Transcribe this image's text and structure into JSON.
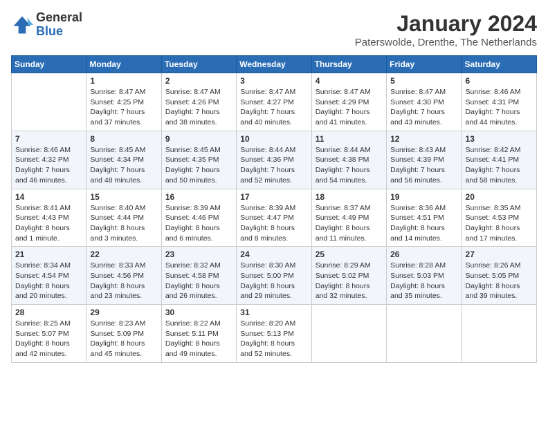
{
  "header": {
    "logo_general": "General",
    "logo_blue": "Blue",
    "month_title": "January 2024",
    "location": "Paterswolde, Drenthe, The Netherlands"
  },
  "weekdays": [
    "Sunday",
    "Monday",
    "Tuesday",
    "Wednesday",
    "Thursday",
    "Friday",
    "Saturday"
  ],
  "weeks": [
    [
      {
        "day": "",
        "sunrise": "",
        "sunset": "",
        "daylight": ""
      },
      {
        "day": "1",
        "sunrise": "Sunrise: 8:47 AM",
        "sunset": "Sunset: 4:25 PM",
        "daylight": "Daylight: 7 hours and 37 minutes."
      },
      {
        "day": "2",
        "sunrise": "Sunrise: 8:47 AM",
        "sunset": "Sunset: 4:26 PM",
        "daylight": "Daylight: 7 hours and 38 minutes."
      },
      {
        "day": "3",
        "sunrise": "Sunrise: 8:47 AM",
        "sunset": "Sunset: 4:27 PM",
        "daylight": "Daylight: 7 hours and 40 minutes."
      },
      {
        "day": "4",
        "sunrise": "Sunrise: 8:47 AM",
        "sunset": "Sunset: 4:29 PM",
        "daylight": "Daylight: 7 hours and 41 minutes."
      },
      {
        "day": "5",
        "sunrise": "Sunrise: 8:47 AM",
        "sunset": "Sunset: 4:30 PM",
        "daylight": "Daylight: 7 hours and 43 minutes."
      },
      {
        "day": "6",
        "sunrise": "Sunrise: 8:46 AM",
        "sunset": "Sunset: 4:31 PM",
        "daylight": "Daylight: 7 hours and 44 minutes."
      }
    ],
    [
      {
        "day": "7",
        "sunrise": "Sunrise: 8:46 AM",
        "sunset": "Sunset: 4:32 PM",
        "daylight": "Daylight: 7 hours and 46 minutes."
      },
      {
        "day": "8",
        "sunrise": "Sunrise: 8:45 AM",
        "sunset": "Sunset: 4:34 PM",
        "daylight": "Daylight: 7 hours and 48 minutes."
      },
      {
        "day": "9",
        "sunrise": "Sunrise: 8:45 AM",
        "sunset": "Sunset: 4:35 PM",
        "daylight": "Daylight: 7 hours and 50 minutes."
      },
      {
        "day": "10",
        "sunrise": "Sunrise: 8:44 AM",
        "sunset": "Sunset: 4:36 PM",
        "daylight": "Daylight: 7 hours and 52 minutes."
      },
      {
        "day": "11",
        "sunrise": "Sunrise: 8:44 AM",
        "sunset": "Sunset: 4:38 PM",
        "daylight": "Daylight: 7 hours and 54 minutes."
      },
      {
        "day": "12",
        "sunrise": "Sunrise: 8:43 AM",
        "sunset": "Sunset: 4:39 PM",
        "daylight": "Daylight: 7 hours and 56 minutes."
      },
      {
        "day": "13",
        "sunrise": "Sunrise: 8:42 AM",
        "sunset": "Sunset: 4:41 PM",
        "daylight": "Daylight: 7 hours and 58 minutes."
      }
    ],
    [
      {
        "day": "14",
        "sunrise": "Sunrise: 8:41 AM",
        "sunset": "Sunset: 4:43 PM",
        "daylight": "Daylight: 8 hours and 1 minute."
      },
      {
        "day": "15",
        "sunrise": "Sunrise: 8:40 AM",
        "sunset": "Sunset: 4:44 PM",
        "daylight": "Daylight: 8 hours and 3 minutes."
      },
      {
        "day": "16",
        "sunrise": "Sunrise: 8:39 AM",
        "sunset": "Sunset: 4:46 PM",
        "daylight": "Daylight: 8 hours and 6 minutes."
      },
      {
        "day": "17",
        "sunrise": "Sunrise: 8:39 AM",
        "sunset": "Sunset: 4:47 PM",
        "daylight": "Daylight: 8 hours and 8 minutes."
      },
      {
        "day": "18",
        "sunrise": "Sunrise: 8:37 AM",
        "sunset": "Sunset: 4:49 PM",
        "daylight": "Daylight: 8 hours and 11 minutes."
      },
      {
        "day": "19",
        "sunrise": "Sunrise: 8:36 AM",
        "sunset": "Sunset: 4:51 PM",
        "daylight": "Daylight: 8 hours and 14 minutes."
      },
      {
        "day": "20",
        "sunrise": "Sunrise: 8:35 AM",
        "sunset": "Sunset: 4:53 PM",
        "daylight": "Daylight: 8 hours and 17 minutes."
      }
    ],
    [
      {
        "day": "21",
        "sunrise": "Sunrise: 8:34 AM",
        "sunset": "Sunset: 4:54 PM",
        "daylight": "Daylight: 8 hours and 20 minutes."
      },
      {
        "day": "22",
        "sunrise": "Sunrise: 8:33 AM",
        "sunset": "Sunset: 4:56 PM",
        "daylight": "Daylight: 8 hours and 23 minutes."
      },
      {
        "day": "23",
        "sunrise": "Sunrise: 8:32 AM",
        "sunset": "Sunset: 4:58 PM",
        "daylight": "Daylight: 8 hours and 26 minutes."
      },
      {
        "day": "24",
        "sunrise": "Sunrise: 8:30 AM",
        "sunset": "Sunset: 5:00 PM",
        "daylight": "Daylight: 8 hours and 29 minutes."
      },
      {
        "day": "25",
        "sunrise": "Sunrise: 8:29 AM",
        "sunset": "Sunset: 5:02 PM",
        "daylight": "Daylight: 8 hours and 32 minutes."
      },
      {
        "day": "26",
        "sunrise": "Sunrise: 8:28 AM",
        "sunset": "Sunset: 5:03 PM",
        "daylight": "Daylight: 8 hours and 35 minutes."
      },
      {
        "day": "27",
        "sunrise": "Sunrise: 8:26 AM",
        "sunset": "Sunset: 5:05 PM",
        "daylight": "Daylight: 8 hours and 39 minutes."
      }
    ],
    [
      {
        "day": "28",
        "sunrise": "Sunrise: 8:25 AM",
        "sunset": "Sunset: 5:07 PM",
        "daylight": "Daylight: 8 hours and 42 minutes."
      },
      {
        "day": "29",
        "sunrise": "Sunrise: 8:23 AM",
        "sunset": "Sunset: 5:09 PM",
        "daylight": "Daylight: 8 hours and 45 minutes."
      },
      {
        "day": "30",
        "sunrise": "Sunrise: 8:22 AM",
        "sunset": "Sunset: 5:11 PM",
        "daylight": "Daylight: 8 hours and 49 minutes."
      },
      {
        "day": "31",
        "sunrise": "Sunrise: 8:20 AM",
        "sunset": "Sunset: 5:13 PM",
        "daylight": "Daylight: 8 hours and 52 minutes."
      },
      {
        "day": "",
        "sunrise": "",
        "sunset": "",
        "daylight": ""
      },
      {
        "day": "",
        "sunrise": "",
        "sunset": "",
        "daylight": ""
      },
      {
        "day": "",
        "sunrise": "",
        "sunset": "",
        "daylight": ""
      }
    ]
  ]
}
